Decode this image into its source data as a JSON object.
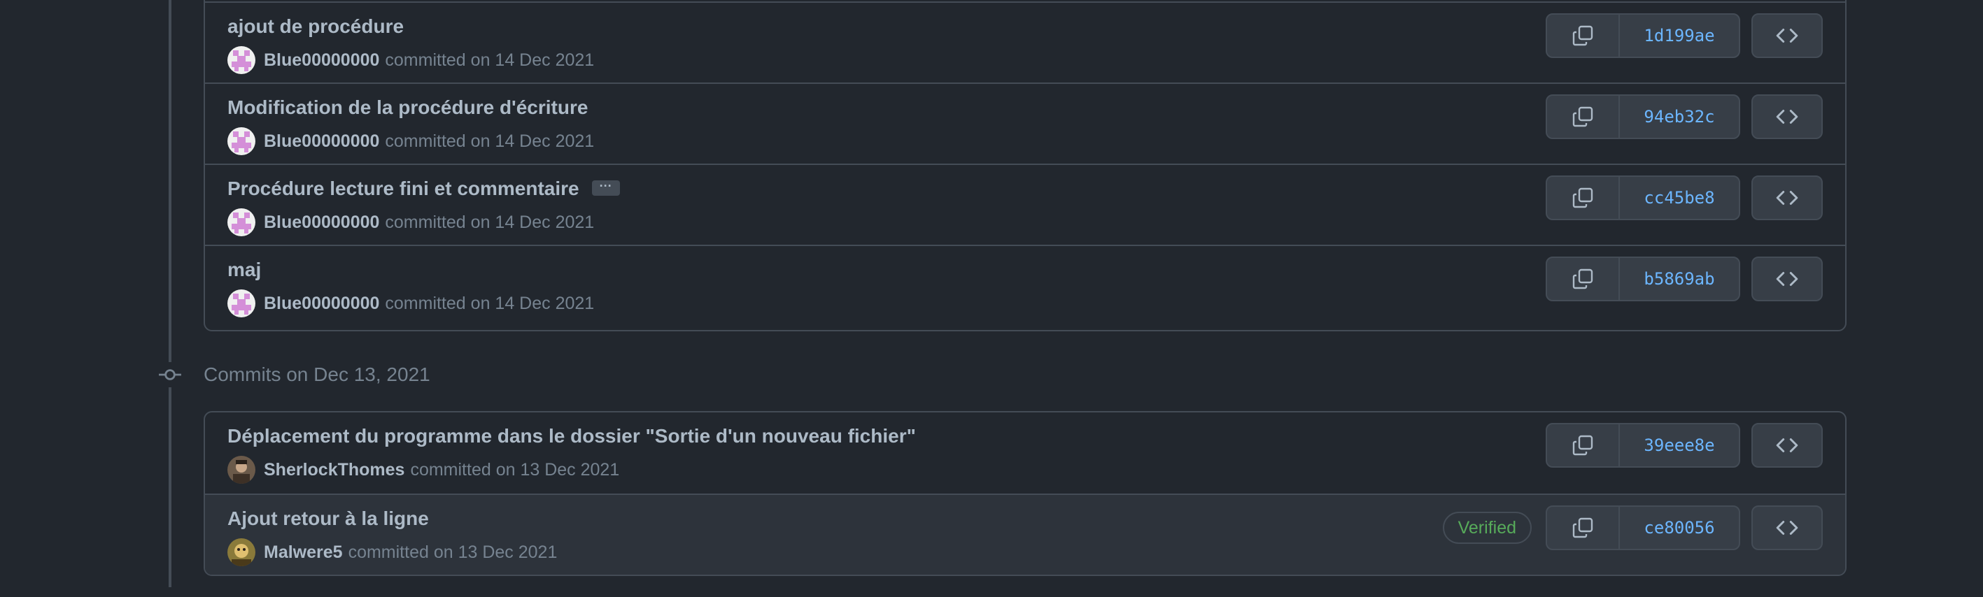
{
  "groups": [
    {
      "commits": [
        {
          "title": "ajout de procédure",
          "author": "Blue00000000",
          "date_text": "committed on 14 Dec 2021",
          "sha": "1d199ae"
        },
        {
          "title": "Modification de la procédure d'écriture",
          "author": "Blue00000000",
          "date_text": "committed on 14 Dec 2021",
          "sha": "94eb32c"
        },
        {
          "title": "Procédure lecture fini et commentaire",
          "author": "Blue00000000",
          "date_text": "committed on 14 Dec 2021",
          "sha": "cc45be8",
          "ellipsis": "···"
        },
        {
          "title": "maj",
          "author": "Blue00000000",
          "date_text": "committed on 14 Dec 2021",
          "sha": "b5869ab"
        }
      ]
    },
    {
      "header": "Commits on Dec 13, 2021",
      "commits": [
        {
          "title": "Déplacement du programme dans le dossier \"Sortie d'un nouveau fichier\"",
          "author": "SherlockThomes",
          "date_text": "committed on 13 Dec 2021",
          "sha": "39eee8e"
        },
        {
          "title": "Ajout retour à la ligne",
          "author": "Malwere5",
          "date_text": "committed on 13 Dec 2021",
          "sha": "ce80056",
          "badge": "Verified"
        }
      ]
    }
  ],
  "icons": {
    "copy": "copy-icon",
    "browse": "code-icon",
    "commit_node": "git-commit-icon"
  },
  "colors": {
    "background": "#22272e",
    "border": "#444c56",
    "sha": "#6cb6ff",
    "verified": "#57ab5a"
  }
}
